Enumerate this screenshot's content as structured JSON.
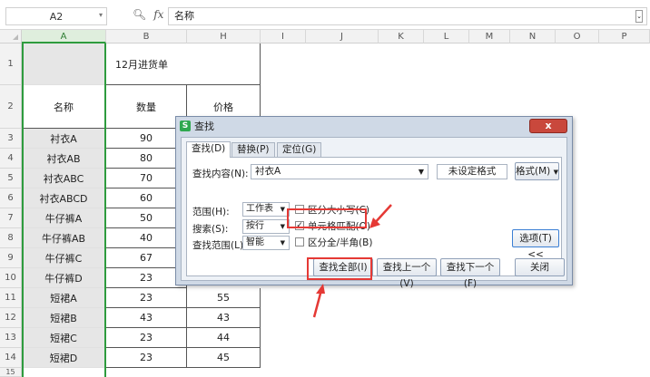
{
  "formula_bar": {
    "cell_ref": "A2",
    "content": "名称",
    "fx_label": "fx"
  },
  "columns": [
    "A",
    "B",
    "H",
    "I",
    "J",
    "K",
    "L",
    "M",
    "N",
    "O",
    "P"
  ],
  "rows": [
    "1",
    "2",
    "3",
    "4",
    "5",
    "6",
    "7",
    "8",
    "9",
    "10",
    "11",
    "12",
    "13",
    "14",
    "15"
  ],
  "sheet": {
    "title": "12月进货单",
    "header_name": "名称",
    "header_qty": "数量",
    "header_price": "价格",
    "items": [
      {
        "name": "衬衣A",
        "qty": "90"
      },
      {
        "name": "衬衣AB",
        "qty": "80"
      },
      {
        "name": "衬衣ABC",
        "qty": "70"
      },
      {
        "name": "衬衣ABCD",
        "qty": "60"
      },
      {
        "name": "牛仔裤A",
        "qty": "50"
      },
      {
        "name": "牛仔裤AB",
        "qty": "40"
      },
      {
        "name": "牛仔裤C",
        "qty": "67"
      },
      {
        "name": "牛仔裤D",
        "qty": "23"
      },
      {
        "name": "短裙A",
        "qty": "23",
        "price": "55"
      },
      {
        "name": "短裙B",
        "qty": "43",
        "price": "43"
      },
      {
        "name": "短裙C",
        "qty": "23",
        "price": "44"
      },
      {
        "name": "短裙D",
        "qty": "23",
        "price": "45"
      }
    ]
  },
  "dialog": {
    "title": "查找",
    "close_symbol": "x",
    "tabs": [
      "查找(D)",
      "替换(P)",
      "定位(G)"
    ],
    "find_label": "查找内容(N):",
    "find_value": "衬衣A",
    "format_status": "未设定格式",
    "format_button": "格式(M)",
    "scope_label": "范围(H):",
    "scope_value": "工作表",
    "search_label": "搜索(S):",
    "search_value": "按行",
    "lookin_label": "查找范围(L):",
    "lookin_value": "智能",
    "opt_case": "区分大小写(C)",
    "opt_cell": "单元格匹配(O)",
    "opt_width": "区分全/半角(B)",
    "options_button": "选项(T) <<",
    "find_all": "查找全部(I)",
    "find_prev": "查找上一个(V)",
    "find_next": "查找下一个(F)",
    "close_button": "关闭"
  },
  "colors": {
    "accent": "#2e9b3e",
    "highlight": "#e53935"
  }
}
